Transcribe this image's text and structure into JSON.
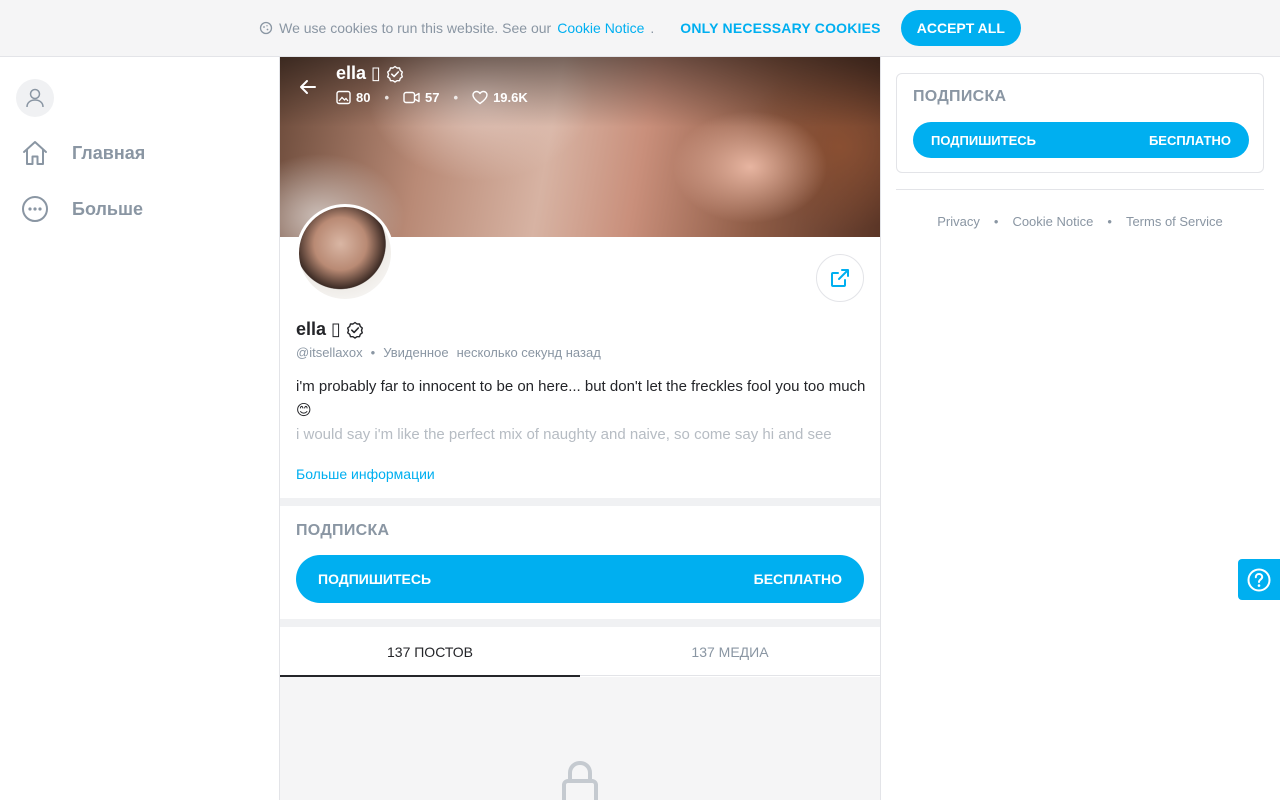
{
  "cookie_bar": {
    "text": "We use cookies to run this website. See our",
    "link": "Cookie Notice",
    "period": ".",
    "necessary": "ONLY NECESSARY COOKIES",
    "accept": "ACCEPT ALL"
  },
  "sidebar": {
    "items": [
      {
        "label": "Главная",
        "icon": "home-icon"
      },
      {
        "label": "Больше",
        "icon": "more-icon"
      }
    ]
  },
  "profile": {
    "name": "ella",
    "name_glyph": "▯",
    "stats": {
      "photos": "80",
      "videos": "57",
      "likes": "19.6K"
    },
    "handle": "@itsellaxox",
    "seen_label": "Увиденное",
    "seen_time": "несколько секунд назад",
    "bio_line1": "i'm probably far to innocent to be on here... but don't let the freckles fool you too much 😊",
    "bio_line2": "i would say i'm like the perfect mix of naughty and naive, so come say hi and see",
    "more_info": "Больше информации"
  },
  "subscription": {
    "title": "ПОДПИСКА",
    "button_label": "ПОДПИШИТЕСЬ",
    "button_price": "БЕСПЛАТНО"
  },
  "tabs": [
    {
      "label": "137 ПОСТОВ",
      "active": true
    },
    {
      "label": "137 МЕДИА",
      "active": false
    }
  ],
  "footer": {
    "links": [
      "Privacy",
      "Cookie Notice",
      "Terms of Service"
    ]
  },
  "colors": {
    "accent": "#00aff0",
    "muted": "#8a96a3",
    "text": "#242529"
  }
}
